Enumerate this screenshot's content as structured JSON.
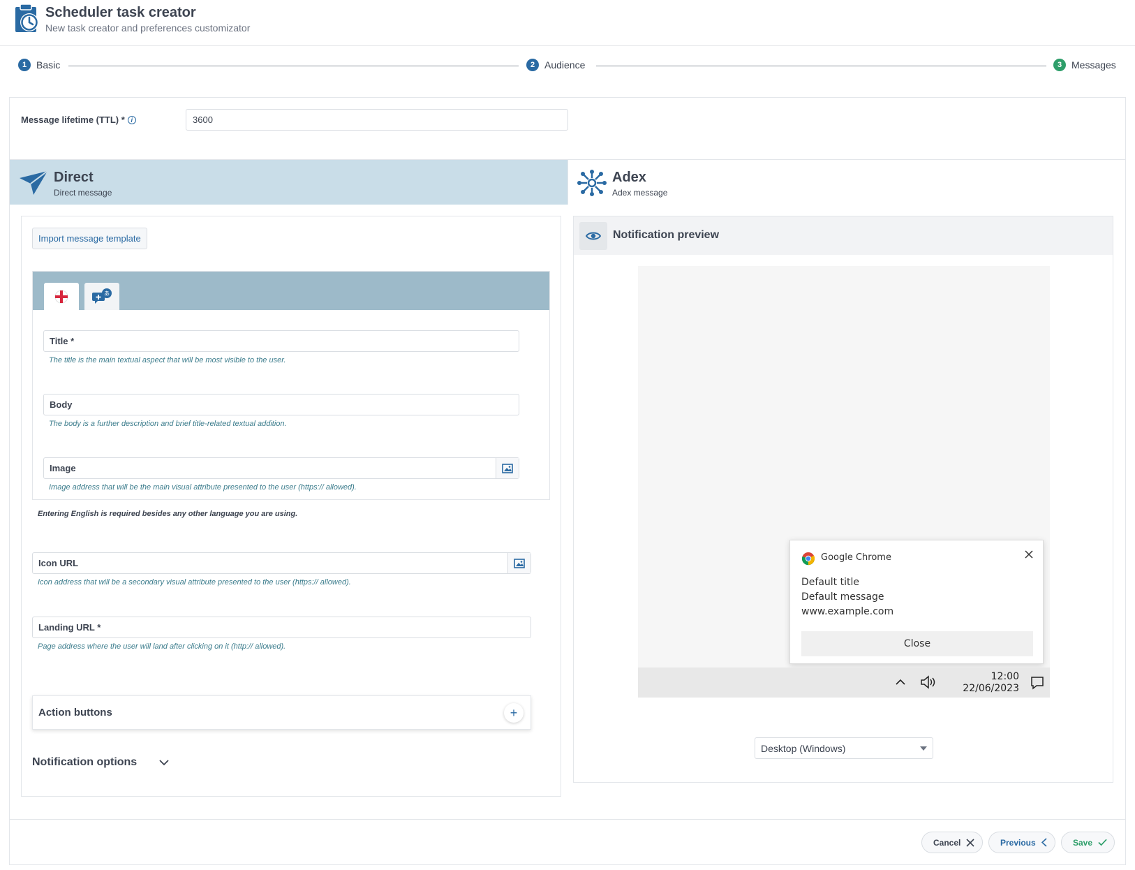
{
  "header": {
    "title": "Scheduler task creator",
    "subtitle": "New task creator and preferences customizator",
    "logo_icon": "clipboard-clock-icon"
  },
  "stepper": {
    "steps": [
      {
        "number": "1",
        "label": "Basic",
        "status": "done",
        "color": "#2a6aa3"
      },
      {
        "number": "2",
        "label": "Audience",
        "status": "done",
        "color": "#2a6aa3"
      },
      {
        "number": "3",
        "label": "Messages",
        "status": "current",
        "color": "#2e9e6a"
      }
    ]
  },
  "ttl": {
    "label": "Message lifetime (TTL) *",
    "info_icon": "info-icon",
    "value": "3600"
  },
  "channels": {
    "direct": {
      "name": "Direct",
      "description": "Direct message",
      "icon": "paper-plane-icon",
      "selected": true
    },
    "adex": {
      "name": "Adex",
      "description": "Adex message",
      "icon": "network-hub-icon",
      "selected": false
    }
  },
  "editor": {
    "import_label": "Import message template",
    "lang_tabs": [
      {
        "icon": "english-flag-icon",
        "active": true
      },
      {
        "icon": "add-language-icon",
        "active": false
      }
    ],
    "title_field": {
      "label": "Title *",
      "hint": "The title is the main textual aspect that will be most visible to the user."
    },
    "body_field": {
      "label": "Body",
      "hint": "The body is a further description and brief title-related textual addition."
    },
    "image_field": {
      "label": "Image",
      "hint": "Image address that will be the main visual attribute presented to the user (https:// allowed)."
    },
    "english_note": "Entering English is required besides any other language you are using.",
    "icon_url_field": {
      "label": "Icon URL",
      "hint": "Icon address that will be a secondary visual attribute presented to the user (https:// allowed)."
    },
    "landing_url_field": {
      "label": "Landing URL *",
      "hint": "Page address where the user will land after clicking on it (http:// allowed)."
    },
    "action_buttons_label": "Action buttons",
    "notification_options_label": "Notification options"
  },
  "preview": {
    "title": "Notification preview",
    "toast": {
      "app": "Google Chrome",
      "title": "Default title",
      "message": "Default message",
      "url": "www.example.com",
      "close_label": "Close"
    },
    "taskbar": {
      "time": "12:00",
      "date": "22/06/2023"
    },
    "device": "Desktop (Windows)"
  },
  "footer": {
    "cancel_label": "Cancel",
    "previous_label": "Previous",
    "save_label": "Save"
  },
  "colors": {
    "primary": "#2a6aa3",
    "success": "#2e9e6a",
    "selected_tab": "#c9dde8",
    "lang_bar": "#9dbac9",
    "hint_text": "#3b7c8c"
  }
}
